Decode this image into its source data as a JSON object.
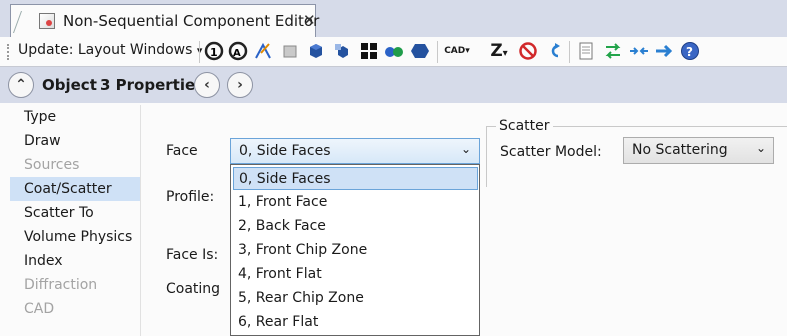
{
  "tab": {
    "title": "Non-Sequential Component Editor",
    "close": "✕"
  },
  "toolbar": {
    "update_label": "Update: Layout Windows",
    "dropdown_arrow": "▾",
    "cad_label": "CAD",
    "z_label": "Z"
  },
  "object_bar": {
    "collapse_glyph": "⌃",
    "object_label": "Object",
    "properties_label": "3 Properties",
    "prev_glyph": "‹",
    "next_glyph": "›"
  },
  "nav": {
    "items": [
      {
        "label": "Type",
        "state": "normal"
      },
      {
        "label": "Draw",
        "state": "normal"
      },
      {
        "label": "Sources",
        "state": "disabled"
      },
      {
        "label": "Coat/Scatter",
        "state": "selected"
      },
      {
        "label": "Scatter To",
        "state": "normal"
      },
      {
        "label": "Volume Physics",
        "state": "normal"
      },
      {
        "label": "Index",
        "state": "normal"
      },
      {
        "label": "Diffraction",
        "state": "disabled"
      },
      {
        "label": "CAD",
        "state": "disabled"
      }
    ]
  },
  "form": {
    "face_label": "Face",
    "profile_label": "Profile:",
    "face_is_label": "Face Is:",
    "coating_label": "Coating",
    "face_value": "0, Side Faces",
    "face_options": [
      "0, Side Faces",
      "1, Front Face",
      "2, Back Face",
      "3, Front Chip Zone",
      "4, Front Flat",
      "5, Rear Chip Zone",
      "6, Rear Flat"
    ],
    "select_arrow": "⌄"
  },
  "scatter": {
    "group_title": "Scatter",
    "model_label": "Scatter Model:",
    "model_value": "No Scattering",
    "select_arrow": "⌄"
  },
  "colors": {
    "accent": "#6ba4d9",
    "selection": "#cfe1f6",
    "chrome": "#d6dbe9"
  }
}
